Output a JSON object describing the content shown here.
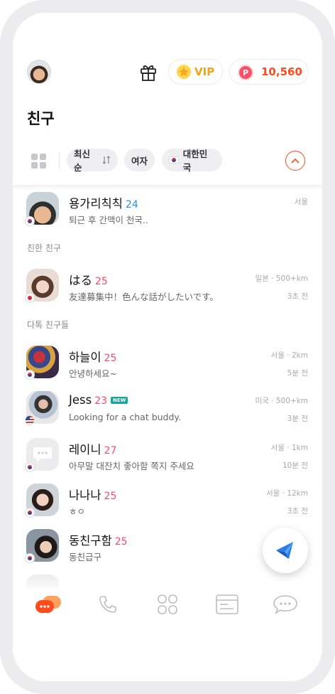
{
  "header": {
    "vip_label": "VIP",
    "coin_symbol": "P",
    "coin_balance": "10,560",
    "title": "친구"
  },
  "filters": {
    "sort_label": "최신순",
    "gender_label": "여자",
    "country_label": "대한민국"
  },
  "me": {
    "name": "용가리칙칙",
    "age": "24",
    "status": "퇴근 후 간맥이 천국..",
    "location": "서울"
  },
  "sections": {
    "close": "친한 친구",
    "many": "다톡 친구들"
  },
  "close_friends": [
    {
      "name": "はる",
      "age": "25",
      "status": "友達募集中！色んな話がしたいです。",
      "meta": "일본 · 500+km",
      "time": "3초 전",
      "flag": "jp"
    }
  ],
  "friends": [
    {
      "name": "하늘이",
      "age": "25",
      "status": "안녕하세요~",
      "meta": "서울 · 2km",
      "time": "5분 전",
      "flag": "kr"
    },
    {
      "name": "Jess",
      "age": "23",
      "badge": "NEW",
      "status": "Looking for a chat buddy.",
      "meta": "미국 · 500+km",
      "time": "3분 전",
      "flag": "us"
    },
    {
      "name": "레이니",
      "age": "27",
      "status": "아무말 대잔치 좋아함 쪽지 주세요",
      "meta": "서울 · 1km",
      "time": "10분 전",
      "flag": "kr"
    },
    {
      "name": "나나나",
      "age": "25",
      "status": "ㅎㅇ",
      "meta": "서울 · 12km",
      "time": "3초 전",
      "flag": "kr"
    },
    {
      "name": "동친구함",
      "age": "25",
      "status": "동친급구",
      "meta": "서울",
      "time": "",
      "flag": "kr"
    }
  ],
  "colors": {
    "accent": "#ff4a1c",
    "vip": "#f0a21a",
    "male_age": "#2a8ee8",
    "female_age": "#ff4a6a"
  },
  "nav": [
    "friends-icon",
    "phone-icon",
    "apps-icon",
    "board-icon",
    "chat-icon"
  ]
}
